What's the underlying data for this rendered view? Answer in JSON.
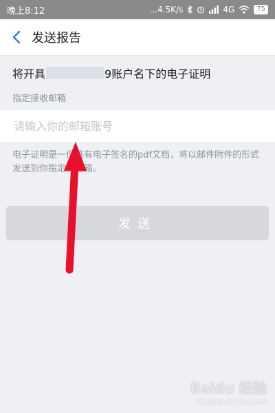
{
  "status_bar": {
    "time": "晚上8:12",
    "signal_text": "...4.5K/s",
    "network": "4G",
    "battery": "75"
  },
  "nav": {
    "title": "发送报告"
  },
  "report": {
    "title_prefix": "将开具",
    "title_suffix": "9账户名下的电子证明",
    "email_label": "指定接收邮箱"
  },
  "email_input": {
    "placeholder": "请输入你的邮箱账号",
    "value": ""
  },
  "description": "电子证明是一份具有电子签名的pdf文档，将以邮件附件的形式发送到你指定的邮箱。",
  "send_button": {
    "label": "发送"
  },
  "watermark": {
    "brand": "Baidu 经验",
    "url": "jingyan.baidu.com"
  },
  "colors": {
    "accent": "#2f7ae5",
    "arrow": "#e8102a",
    "button_disabled": "#d7d8dc"
  }
}
